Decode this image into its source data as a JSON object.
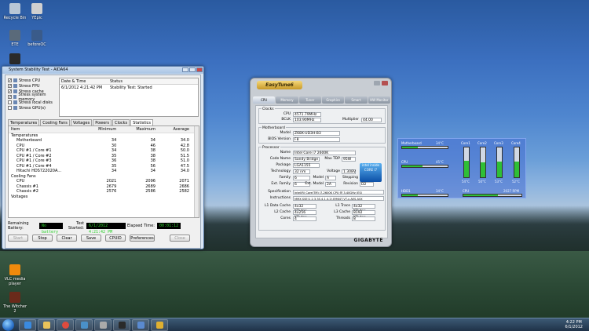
{
  "desktop": {
    "icons": [
      {
        "label": "Recycle Bin",
        "color": "#b9c7d6"
      },
      {
        "label": "YEpic",
        "color": "#d0d0d0"
      },
      {
        "label": "ETE",
        "color": "#5a6a7a"
      },
      {
        "label": "beforeOC",
        "color": "#3a5b8a"
      },
      {
        "label": "VLC media player",
        "color": "#f08a0c"
      },
      {
        "label": "The Witcher 2",
        "color": "#6a2a1a"
      }
    ]
  },
  "aida": {
    "title": "System Stability Test - AIDA64",
    "checks": [
      {
        "label": "Stress CPU",
        "checked": "✓"
      },
      {
        "label": "Stress FPU",
        "checked": "✓"
      },
      {
        "label": "Stress cache",
        "checked": "✓"
      },
      {
        "label": "Stress system memory",
        "checked": "✓"
      },
      {
        "label": "Stress local disks",
        "checked": ""
      },
      {
        "label": "Stress GPU(s)",
        "checked": ""
      }
    ],
    "log_headers": {
      "date": "Date & Time",
      "status": "Status"
    },
    "log_row": {
      "date": "6/1/2012 4:21:42 PM",
      "status": "Stability Test: Started"
    },
    "tabs": [
      "Temperatures",
      "Cooling Fans",
      "Voltages",
      "Powers",
      "Clocks",
      "Statistics"
    ],
    "table_headers": {
      "item": "Item",
      "min": "Minimum",
      "max": "Maximum",
      "avg": "Average"
    },
    "rows": [
      {
        "item": "Temperatures",
        "min": "",
        "max": "",
        "avg": "",
        "level": 0
      },
      {
        "item": "Motherboard",
        "min": "34",
        "max": "34",
        "avg": "34.0",
        "level": 1
      },
      {
        "item": "CPU",
        "min": "30",
        "max": "46",
        "avg": "42.8",
        "level": 1
      },
      {
        "item": "CPU #1 / Core #1",
        "min": "34",
        "max": "38",
        "avg": "50.0",
        "level": 1
      },
      {
        "item": "CPU #1 / Core #2",
        "min": "35",
        "max": "38",
        "avg": "51.5",
        "level": 1
      },
      {
        "item": "CPU #1 / Core #3",
        "min": "36",
        "max": "38",
        "avg": "51.0",
        "level": 1
      },
      {
        "item": "CPU #1 / Core #4",
        "min": "35",
        "max": "56",
        "avg": "47.5",
        "level": 1
      },
      {
        "item": "Hitachi HDS722020A...",
        "min": "34",
        "max": "34",
        "avg": "34.0",
        "level": 1
      },
      {
        "item": "Cooling Fans",
        "min": "",
        "max": "",
        "avg": "",
        "level": 0
      },
      {
        "item": "CPU",
        "min": "2021",
        "max": "2096",
        "avg": "2071",
        "level": 1
      },
      {
        "item": "Chassis #1",
        "min": "2679",
        "max": "2689",
        "avg": "2686",
        "level": 1
      },
      {
        "item": "Chassis #2",
        "min": "2576",
        "max": "2586",
        "avg": "2582",
        "level": 1
      },
      {
        "item": "Voltages",
        "min": "",
        "max": "",
        "avg": "",
        "level": 0
      }
    ],
    "status": {
      "battery_label": "Remaining Battery:",
      "battery_value": "No battery",
      "started_label": "Test Started:",
      "started_value": "6/1/2012 4:21:42 PM",
      "elapsed_label": "Elapsed Time:",
      "elapsed_value": "00:01:12"
    },
    "buttons": [
      "Start",
      "Stop",
      "Clear",
      "Save",
      "CPUID",
      "Preferences",
      "Close"
    ]
  },
  "easytune": {
    "logo": "EasyTune6",
    "tabs": [
      "CPU",
      "Memory",
      "Tuner",
      "Graphics",
      "Smart",
      "HW Monitor"
    ],
    "clocks_title": "Clocks",
    "cpu_label": "CPU",
    "cpu_value": "4571.79MHz",
    "bclk_label": "BCLK",
    "bclk_value": "103.90MHz",
    "mult_label": "Multiplier",
    "mult_value": "44.00",
    "mb_title": "Motherboard",
    "model_label": "Model",
    "model_value": "Z68X-UD3H-B3",
    "bios_label": "BIOS Version",
    "bios_value": "F8",
    "proc_title": "Processor",
    "name_label": "Name",
    "name_value": "Intel Core i7 2600K",
    "codename_label": "Code Name",
    "codename_value": "Sandy Bridge",
    "tdp_label": "Max TDP",
    "tdp_value": "95W",
    "package_label": "Package",
    "package_value": "LGA1155",
    "tech_label": "Technology",
    "tech_value": "32 nm",
    "voltage_label": "Voltage",
    "voltage_value": "1.308V",
    "family_label": "Family",
    "family_value": "6",
    "model2_label": "Model",
    "model2_value": "A",
    "stepping_label": "Stepping",
    "stepping_value": "7",
    "extfam_label": "Ext. Family",
    "extfam_value": "6",
    "extmodel_label": "Ext. Model",
    "extmodel_value": "2A",
    "revision_label": "Revision",
    "revision_value": "D2",
    "spec_label": "Specification",
    "spec_value": "Intel(R) Core(TM) i7-2600K CPU @ 3.40GHz (ES)",
    "instr_label": "Instructions",
    "instr_value": "MMX,SSE(1,2,3,3S,4.1,4.2),EM64T,VT-x,AES,AVX",
    "l1d_label": "L1 Data Cache",
    "l1d_value": "4x32 KBytes",
    "l1t_label": "L1 Trace",
    "l1t_value": "4x32 KBytes",
    "l2_label": "L2 Cache",
    "l2_value": "4x256 KBytes",
    "l3_label": "L3 Cache",
    "l3_value": "8192 KBytes",
    "cores_label": "Cores",
    "cores_value": "4",
    "threads_label": "Threads",
    "threads_value": "8",
    "intel_badge": "intel inside CORE i7",
    "brand": "GIGABYTE"
  },
  "gadget": {
    "mb_label": "Motherboard",
    "mb_value": "34°C",
    "mb_level": 0.34,
    "cpu_label": "CPU",
    "cpu_value": "45°C",
    "cpu_level": 0.45,
    "hdd_label": "HDD1",
    "hdd_value": "34°C",
    "hdd_level": 0.34,
    "fan_label": "CPU",
    "fan_value": "2027 RPM",
    "fan_level": 0.6,
    "cores": [
      {
        "label": "Core1",
        "value": "54°C",
        "level": 0.54
      },
      {
        "label": "Core2",
        "value": "50°C",
        "level": 0.5
      },
      {
        "label": "Core3",
        "value": "53°C",
        "level": 0.53
      },
      {
        "label": "Core4",
        "value": "52°C",
        "level": 0.52
      }
    ]
  },
  "taskbar": {
    "time": "4:22 PM",
    "date": "6/1/2012"
  },
  "colors": {
    "lcd_text": "#2bd12b",
    "bar_green": "#2fbf36",
    "gadget_bg": "#466ed2"
  }
}
